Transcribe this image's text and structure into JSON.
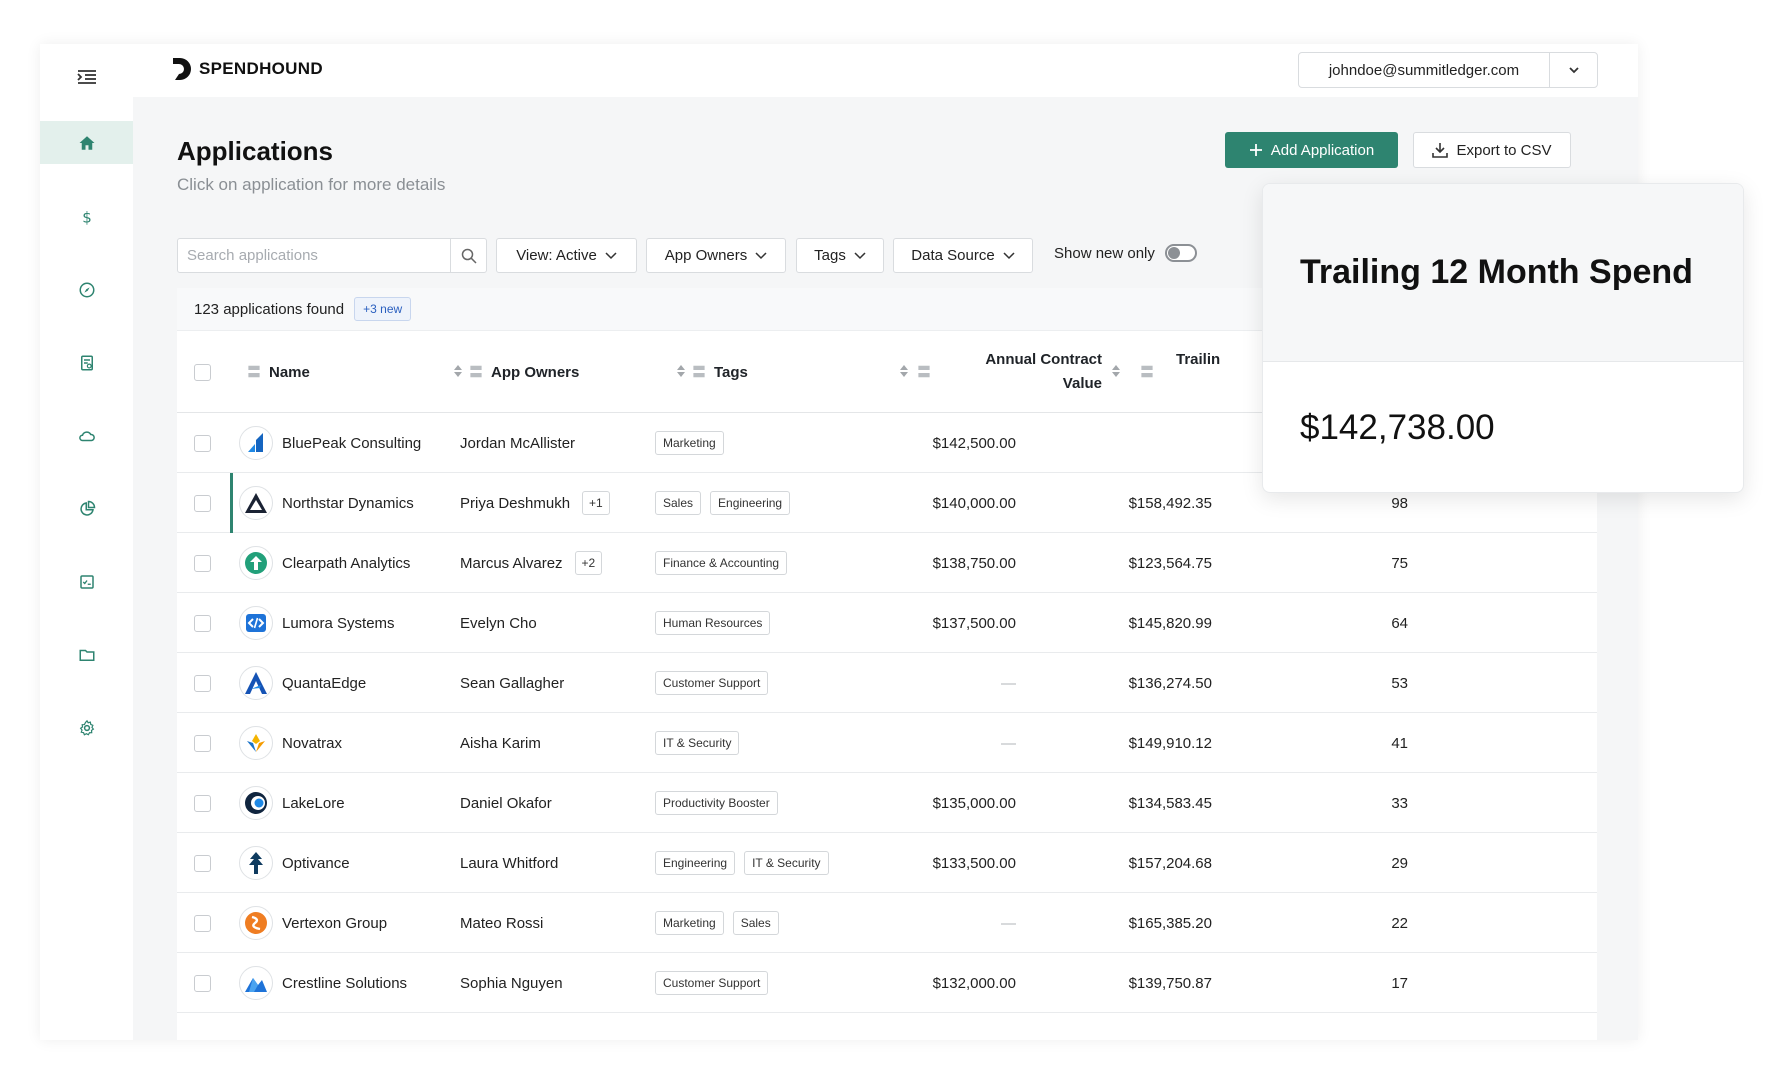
{
  "brand": {
    "name": "SPENDHOUND"
  },
  "user": {
    "email": "johndoe@summitledger.com"
  },
  "page": {
    "title": "Applications",
    "subtitle": "Click on application for more details"
  },
  "actions": {
    "add_label": "Add Application",
    "export_label": "Export to CSV"
  },
  "search": {
    "placeholder": "Search applications"
  },
  "filters": {
    "view": "View: Active",
    "owners": "App Owners",
    "tags": "Tags",
    "source": "Data Source",
    "show_new": "Show new only"
  },
  "summary": {
    "count": "123 applications found",
    "new_badge": "+3 new"
  },
  "columns": {
    "name": "Name",
    "owners": "App Owners",
    "tags": "Tags",
    "acv_line1": "Annual Contract",
    "acv_line2": "Value",
    "trailing": "Trailin"
  },
  "rows": [
    {
      "name": "BluePeak Consulting",
      "owner": "Jordan McAllister",
      "extra": "",
      "tags": [
        "Marketing"
      ],
      "acv": "$142,500.00",
      "spend": "",
      "score": ""
    },
    {
      "name": "Northstar Dynamics",
      "owner": "Priya Deshmukh",
      "extra": "+1",
      "tags": [
        "Sales",
        "Engineering"
      ],
      "acv": "$140,000.00",
      "spend": "$158,492.35",
      "score": "98"
    },
    {
      "name": "Clearpath Analytics",
      "owner": "Marcus Alvarez",
      "extra": "+2",
      "tags": [
        "Finance & Accounting"
      ],
      "acv": "$138,750.00",
      "spend": "$123,564.75",
      "score": "75"
    },
    {
      "name": "Lumora Systems",
      "owner": "Evelyn Cho",
      "extra": "",
      "tags": [
        "Human Resources"
      ],
      "acv": "$137,500.00",
      "spend": "$145,820.99",
      "score": "64"
    },
    {
      "name": "QuantaEdge",
      "owner": "Sean Gallagher",
      "extra": "",
      "tags": [
        "Customer Support"
      ],
      "acv": "—",
      "spend": "$136,274.50",
      "score": "53"
    },
    {
      "name": "Novatrax",
      "owner": "Aisha Karim",
      "extra": "",
      "tags": [
        "IT & Security"
      ],
      "acv": "—",
      "spend": "$149,910.12",
      "score": "41"
    },
    {
      "name": "LakeLore",
      "owner": "Daniel Okafor",
      "extra": "",
      "tags": [
        "Productivity Booster"
      ],
      "acv": "$135,000.00",
      "spend": "$134,583.45",
      "score": "33"
    },
    {
      "name": "Optivance",
      "owner": "Laura Whitford",
      "extra": "",
      "tags": [
        "Engineering",
        "IT & Security"
      ],
      "acv": "$133,500.00",
      "spend": "$157,204.68",
      "score": "29"
    },
    {
      "name": "Vertexon Group",
      "owner": "Mateo Rossi",
      "extra": "",
      "tags": [
        "Marketing",
        "Sales"
      ],
      "acv": "—",
      "spend": "$165,385.20",
      "score": "22"
    },
    {
      "name": "Crestline Solutions",
      "owner": "Sophia Nguyen",
      "extra": "",
      "tags": [
        "Customer Support"
      ],
      "acv": "$132,000.00",
      "spend": "$139,750.87",
      "score": "17"
    }
  ],
  "tooltip": {
    "title": "Trailing 12 Month Spend",
    "value": "$142,738.00"
  },
  "colors": {
    "accent": "#2e8470",
    "nav_icon": "#2e8470",
    "active_nav_bg": "#e3f0ec"
  },
  "icons": {
    "nav": [
      "home-icon",
      "dollar-icon",
      "compass-icon",
      "report-icon",
      "cloud-icon",
      "pie-chart-icon",
      "checklist-icon",
      "folder-icon",
      "gear-icon"
    ],
    "app_logos": [
      "bluepeak-logo-icon",
      "northstar-logo-icon",
      "clearpath-logo-icon",
      "lumora-logo-icon",
      "quantaedge-logo-icon",
      "novatrax-logo-icon",
      "lakelore-logo-icon",
      "optivance-logo-icon",
      "vertexon-logo-icon",
      "crestline-logo-icon"
    ]
  }
}
